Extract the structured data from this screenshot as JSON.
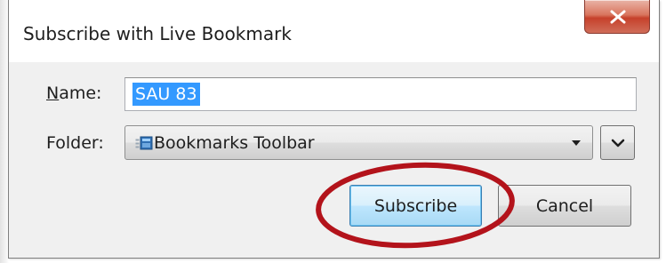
{
  "dialog": {
    "title": "Subscribe with Live Bookmark",
    "close_icon": "close-x-icon"
  },
  "form": {
    "name_label": "Name:",
    "name_access_key": "N",
    "name_value": "SAU 83",
    "folder_label": "Folder:",
    "folder_selected": "Bookmarks Toolbar",
    "folder_icon": "bookmarks-toolbar-icon"
  },
  "buttons": {
    "subscribe": "Subscribe",
    "cancel": "Cancel"
  },
  "colors": {
    "selection": "#3399ff",
    "highlight_ellipse": "#b3131b",
    "close_button": "#c6412b"
  }
}
